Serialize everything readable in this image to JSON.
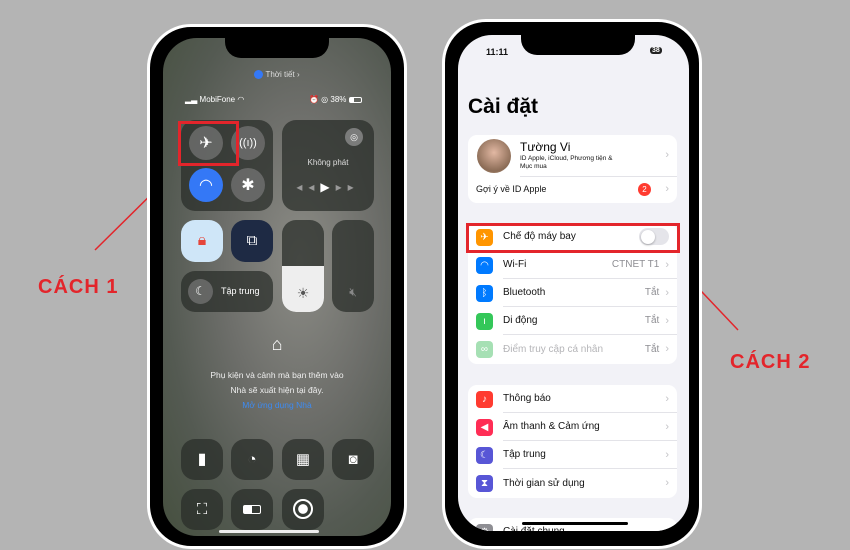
{
  "labels": {
    "cach1": "CÁCH 1",
    "cach2": "CÁCH 2"
  },
  "colors": {
    "highlight": "#e3252b",
    "background": "#b4b4b4",
    "accent": "#3478f6"
  },
  "control_center": {
    "weather": "Thời tiết",
    "carrier": "MobiFone",
    "battery": "38%",
    "media_status": "Không phát",
    "focus_label": "Tập trung",
    "brightness_level": 0.5,
    "home_text_1": "Phụ kiện và cảnh mà bạn thêm vào",
    "home_text_2": "Nhà sẽ xuất hiện tại đây.",
    "home_link": "Mở ứng dụng Nhà",
    "airplane_mode": false,
    "wifi_on": true,
    "bluetooth_on": false
  },
  "settings": {
    "time": "11:11",
    "battery": "38",
    "title": "Cài đặt",
    "profile": {
      "name": "Tường Vi",
      "subtitle_1": "ID Apple, iCloud, Phương tiện &",
      "subtitle_2": "Mục mua",
      "suggest": "Gợi ý về ID Apple",
      "badge": "2"
    },
    "connectivity": [
      {
        "icon": "airplane-icon",
        "label": "Chế độ máy bay",
        "value": "",
        "color": "#ff9500",
        "toggle": false
      },
      {
        "icon": "wifi-icon",
        "label": "Wi-Fi",
        "value": "CTNET T1",
        "color": "#007aff"
      },
      {
        "icon": "bluetooth-icon",
        "label": "Bluetooth",
        "value": "Tắt",
        "color": "#007aff"
      },
      {
        "icon": "cellular-icon",
        "label": "Di động",
        "value": "Tắt",
        "color": "#34c759"
      },
      {
        "icon": "hotspot-icon",
        "label": "Điểm truy cập cá nhân",
        "value": "Tắt",
        "color": "#a6e0b4"
      }
    ],
    "notifications": [
      {
        "icon": "bell-icon",
        "label": "Thông báo",
        "color": "#ff3b30"
      },
      {
        "icon": "speaker-icon",
        "label": "Âm thanh & Cảm ứng",
        "color": "#ff2d55"
      },
      {
        "icon": "moon-icon",
        "label": "Tập trung",
        "color": "#5856d6"
      },
      {
        "icon": "hourglass-icon",
        "label": "Thời gian sử dụng",
        "color": "#5856d6"
      }
    ],
    "general": "Cài đặt chung"
  }
}
